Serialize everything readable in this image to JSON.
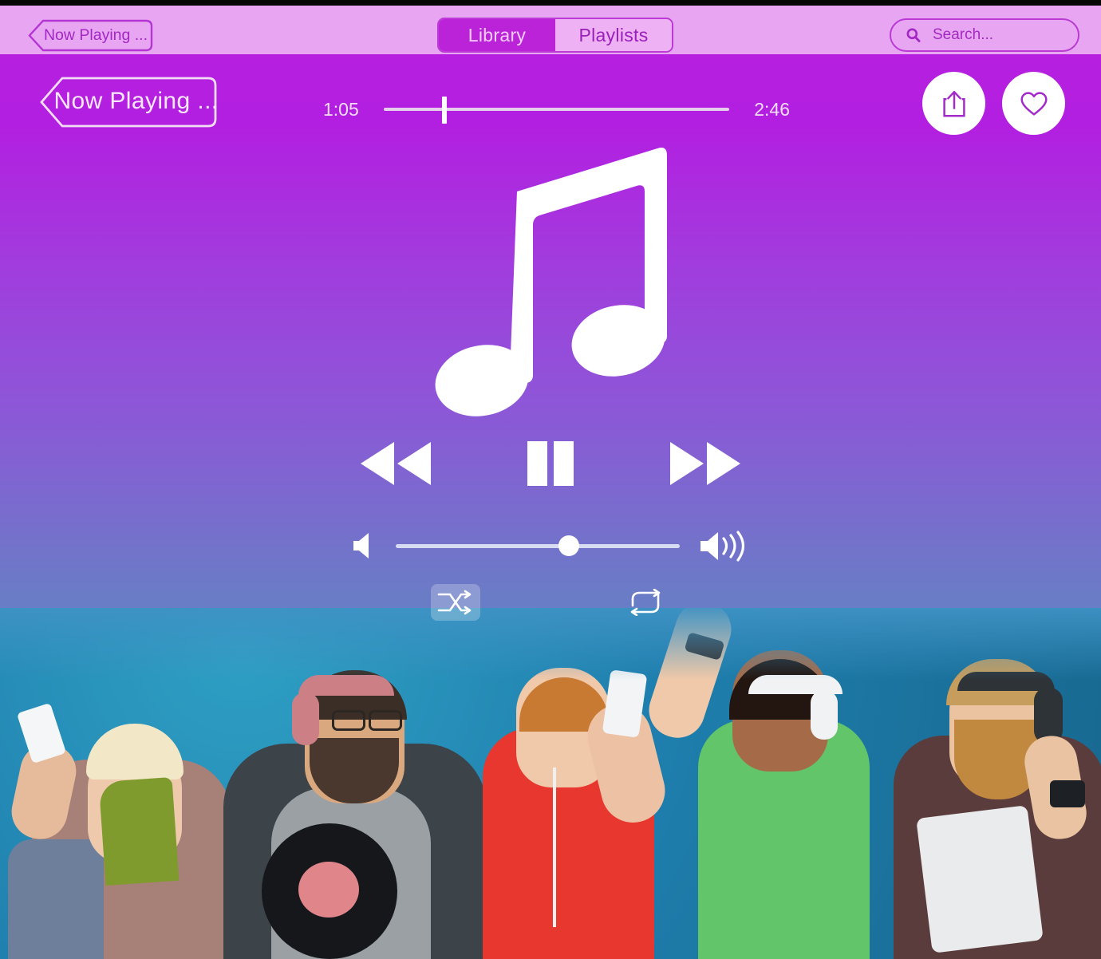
{
  "header": {
    "now_playing_label": "Now Playing ...",
    "tabs": [
      {
        "label": "Library",
        "active": true
      },
      {
        "label": "Playlists",
        "active": false
      }
    ],
    "search": {
      "placeholder": "Search...",
      "value": "",
      "icon": "search-icon"
    },
    "background_color": "#e8a6f2",
    "accent_color": "#bb23d9"
  },
  "player": {
    "now_playing_label": "Now Playing ...",
    "progress": {
      "elapsed": "1:05",
      "remaining": "2:46",
      "percent": 17.5
    },
    "actions": [
      {
        "name": "share-button",
        "icon": "share-icon"
      },
      {
        "name": "favorite-button",
        "icon": "heart-icon"
      }
    ],
    "artwork_icon": "music-note-icon",
    "transport": [
      {
        "name": "previous-button",
        "icon": "rewind-icon",
        "label": "Previous"
      },
      {
        "name": "play-pause-button",
        "icon": "pause-icon",
        "label": "Pause"
      },
      {
        "name": "next-button",
        "icon": "fast-forward-icon",
        "label": "Next"
      }
    ],
    "volume": {
      "percent": 61,
      "min_icon": "volume-low-icon",
      "max_icon": "volume-high-icon"
    },
    "modes": [
      {
        "name": "shuffle-button",
        "icon": "shuffle-icon",
        "active": true
      },
      {
        "name": "repeat-button",
        "icon": "repeat-icon",
        "active": false
      }
    ]
  },
  "background": {
    "gradient_top": "#b61fe0",
    "gradient_bottom": "#2e9cbf",
    "photo_wall_color": "#1f7fae",
    "photo_description": "Five smiling people with headphones, smartphones, a vinyl record and a tablet in front of a blue wall"
  }
}
